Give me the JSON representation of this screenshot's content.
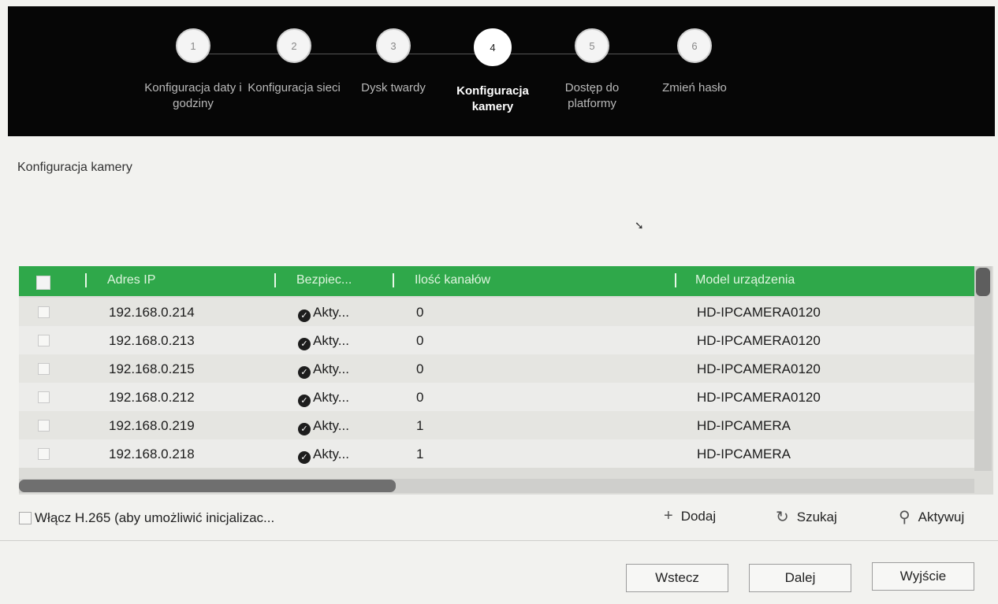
{
  "wizard": {
    "steps": [
      {
        "number": "1",
        "label": "Konfiguracja daty i godziny"
      },
      {
        "number": "2",
        "label": "Konfiguracja sieci"
      },
      {
        "number": "3",
        "label": "Dysk twardy"
      },
      {
        "number": "4",
        "label": "Konfiguracja kamery"
      },
      {
        "number": "5",
        "label": "Dostęp do platformy"
      },
      {
        "number": "6",
        "label": "Zmień hasło"
      }
    ],
    "active_step": 4
  },
  "section": {
    "title": "Konfiguracja kamery"
  },
  "table": {
    "columns": [
      "Adres IP",
      "Bezpiec...",
      "Ilość kanałów",
      "Model urządzenia"
    ],
    "rows": [
      {
        "ip": "192.168.0.214",
        "security": "Akty...",
        "channels": "0",
        "model": "HD-IPCAMERA0120"
      },
      {
        "ip": "192.168.0.213",
        "security": "Akty...",
        "channels": "0",
        "model": "HD-IPCAMERA0120"
      },
      {
        "ip": "192.168.0.215",
        "security": "Akty...",
        "channels": "0",
        "model": "HD-IPCAMERA0120"
      },
      {
        "ip": "192.168.0.212",
        "security": "Akty...",
        "channels": "0",
        "model": "HD-IPCAMERA0120"
      },
      {
        "ip": "192.168.0.219",
        "security": "Akty...",
        "channels": "1",
        "model": "HD-IPCAMERA"
      },
      {
        "ip": "192.168.0.218",
        "security": "Akty...",
        "channels": "1",
        "model": "HD-IPCAMERA"
      }
    ]
  },
  "options": {
    "h265_label": "Włącz H.265 (aby umożliwić inicjalizac..."
  },
  "actions": {
    "add": "Dodaj",
    "search": "Szukaj",
    "activate": "Aktywuj"
  },
  "buttons": {
    "back": "Wstecz",
    "next": "Dalej",
    "exit": "Wyjście"
  },
  "colors": {
    "header_green": "#2fa84a",
    "wizard_bg": "#060606"
  }
}
